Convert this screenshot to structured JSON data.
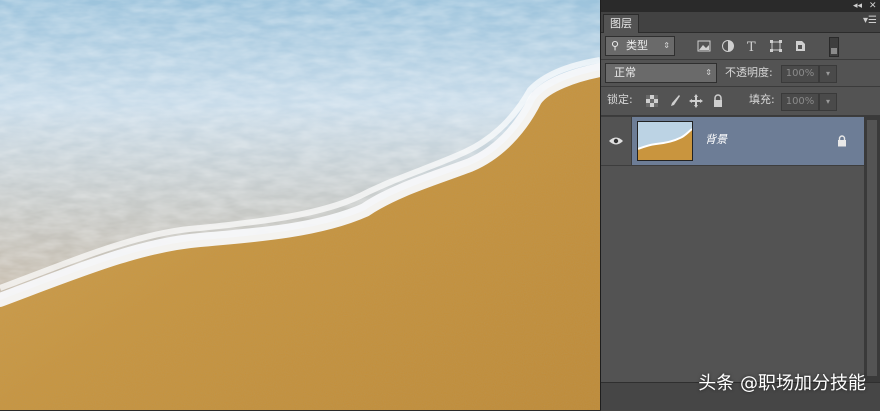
{
  "canvas": {
    "description_icon": "photo-canvas"
  },
  "panel": {
    "tab_label": "图层",
    "filter": {
      "label": "类型",
      "icon": "search-icon"
    },
    "blend_mode": "正常",
    "opacity_label": "不透明度:",
    "opacity_value": "100%",
    "lock_label": "锁定:",
    "fill_label": "填充:",
    "fill_value": "100%",
    "layers": [
      {
        "name": "背景",
        "visible": true,
        "locked": true
      }
    ]
  },
  "watermark": "头条 @职场加分技能",
  "colors": {
    "panel_bg": "#535353",
    "selected_layer": "#6d7d96"
  }
}
